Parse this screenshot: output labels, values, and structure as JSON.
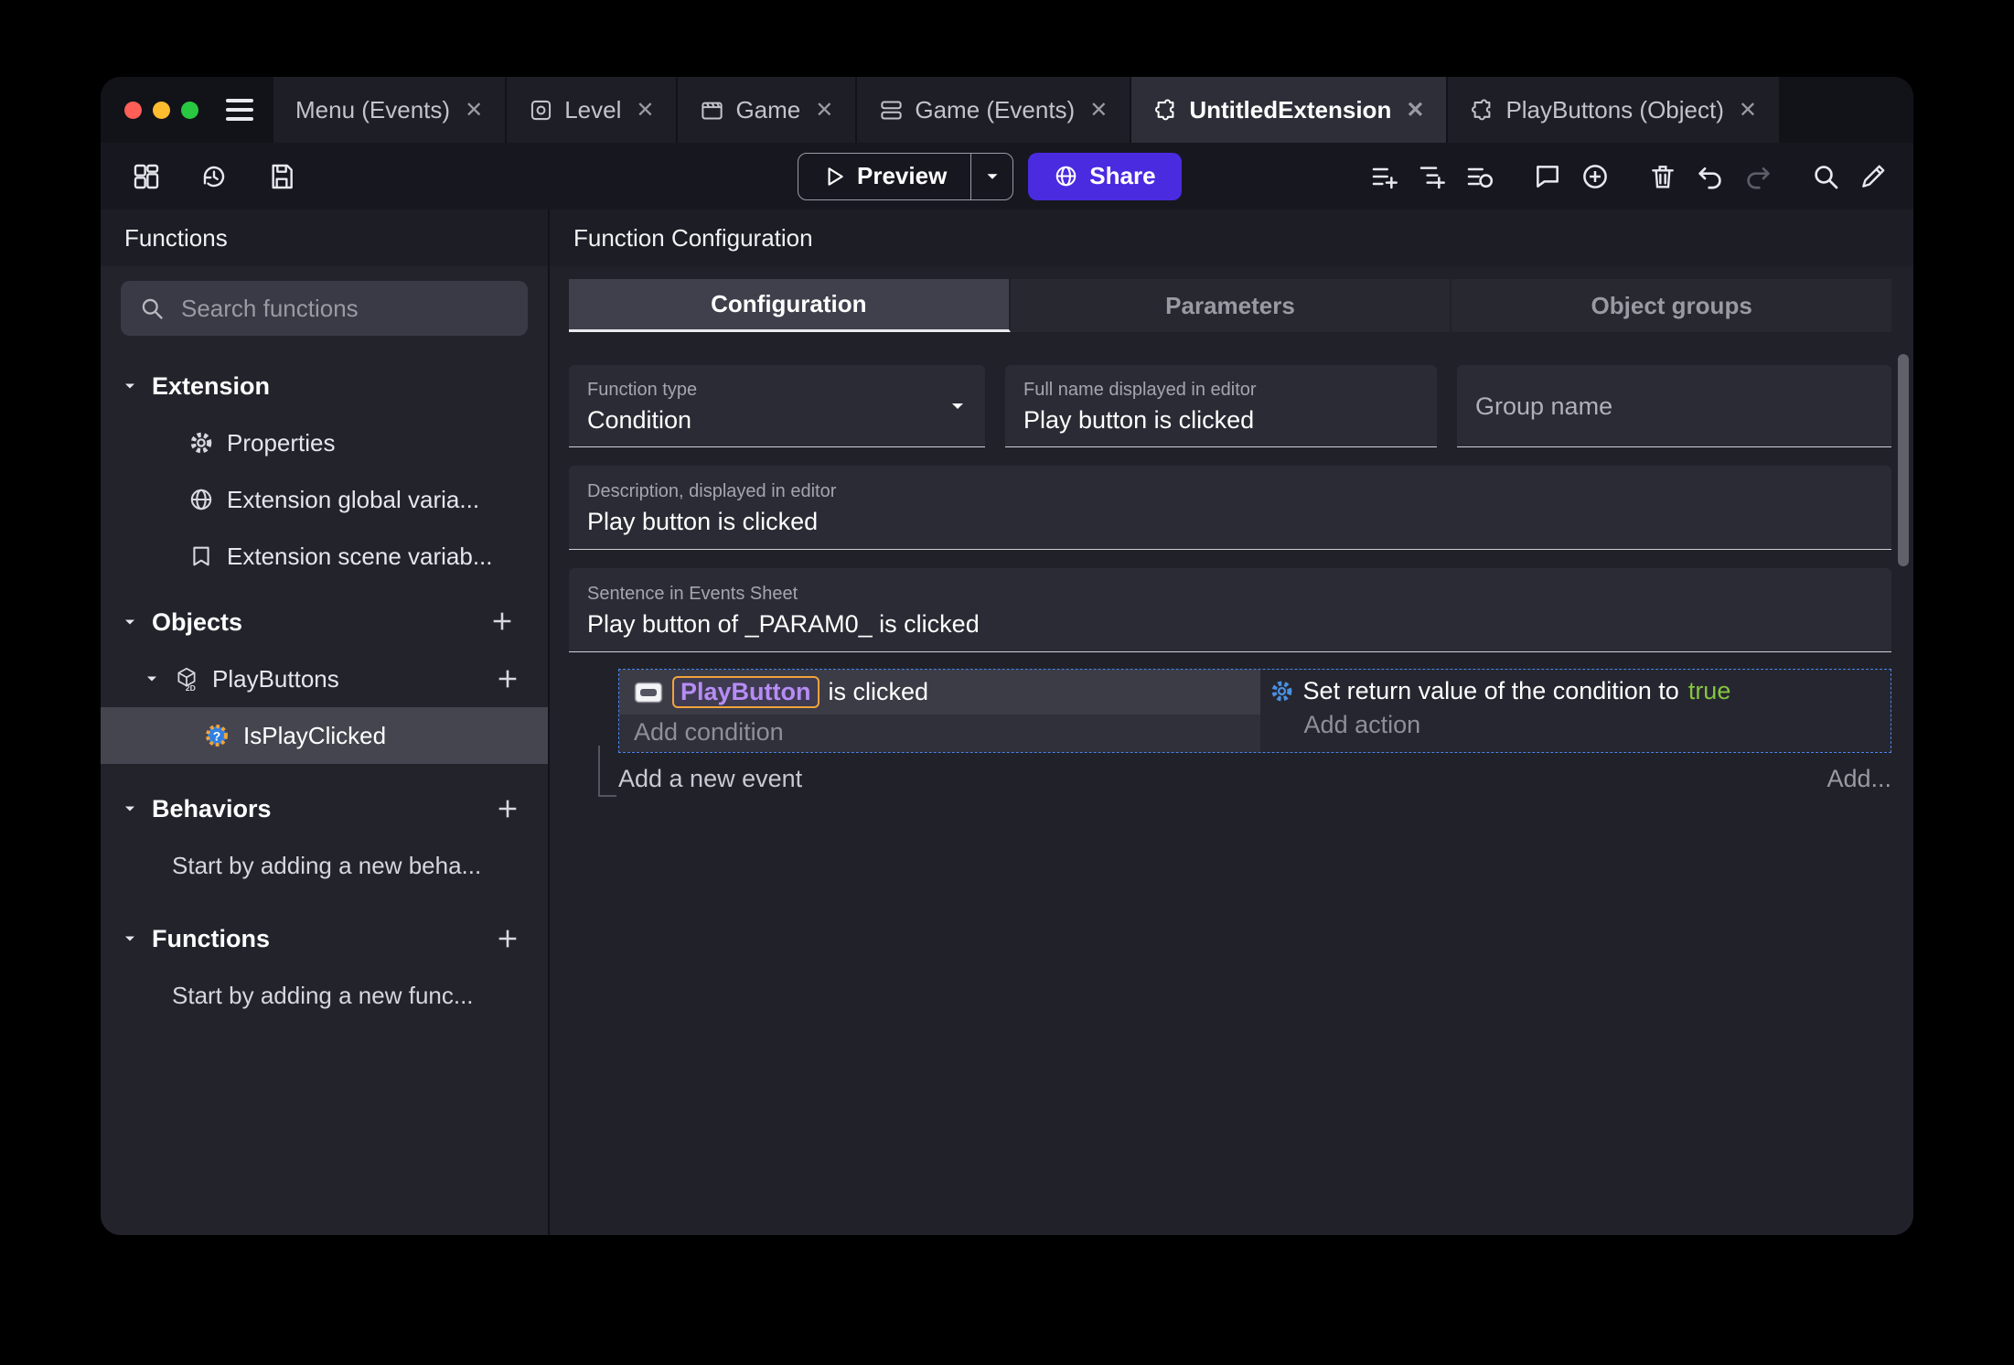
{
  "ui": {
    "close_glyph": "✕"
  },
  "tabs": [
    {
      "label": "Menu (Events)"
    },
    {
      "label": "Level"
    },
    {
      "label": "Game"
    },
    {
      "label": "Game (Events)"
    },
    {
      "label": "UntitledExtension"
    },
    {
      "label": "PlayButtons (Object)"
    }
  ],
  "toolbar": {
    "preview": "Preview",
    "share": "Share"
  },
  "sidebar": {
    "title": "Functions",
    "search_placeholder": "Search functions",
    "sections": {
      "extension": "Extension",
      "objects": "Objects",
      "behaviors": "Behaviors",
      "functions": "Functions"
    },
    "extension_items": [
      {
        "label": "Properties"
      },
      {
        "label": "Extension global varia..."
      },
      {
        "label": "Extension scene variab..."
      }
    ],
    "objects_items": [
      {
        "label": "PlayButtons"
      },
      {
        "label": "IsPlayClicked"
      }
    ],
    "behaviors_hint": "Start by adding a new beha...",
    "functions_hint": "Start by adding a new func..."
  },
  "main": {
    "header": "Function Configuration",
    "tabs": [
      {
        "label": "Configuration"
      },
      {
        "label": "Parameters"
      },
      {
        "label": "Object groups"
      }
    ],
    "fields": {
      "function_type_label": "Function type",
      "function_type_value": "Condition",
      "full_name_label": "Full name displayed in editor",
      "full_name_value": "Play button is clicked",
      "group_name_placeholder": "Group name",
      "description_label": "Description, displayed in editor",
      "description_value": "Play button is clicked",
      "sentence_label": "Sentence in Events Sheet",
      "sentence_value": "Play button of _PARAM0_ is clicked"
    },
    "events": {
      "condition_object": "PlayButton",
      "condition_suffix": " is clicked",
      "add_condition": "Add condition",
      "action_prefix": "Set return value of the condition to ",
      "action_value": "true",
      "add_action": "Add action",
      "add_event": "Add a new event",
      "add_more": "Add..."
    }
  },
  "colors": {
    "accent": "#4a2be0",
    "chip_border": "#f2a33c",
    "chip_text": "#b78cf5",
    "true_value": "#84c440",
    "selection": "#4a86e8"
  }
}
